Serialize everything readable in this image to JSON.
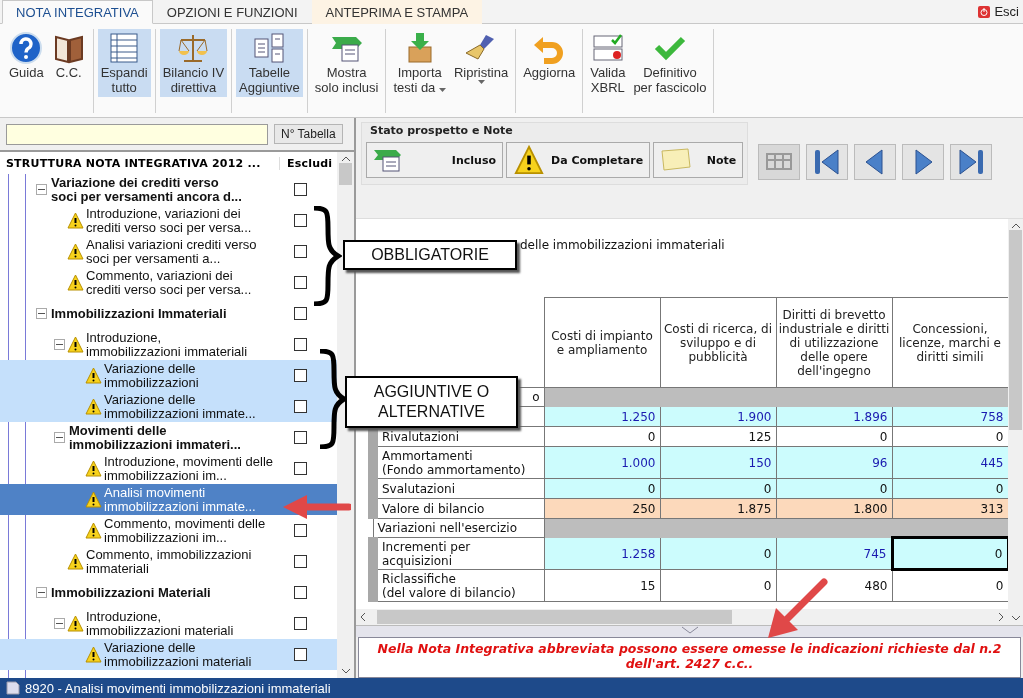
{
  "tabs": [
    {
      "label": "NOTA INTEGRATIVA",
      "selected": true,
      "kind": "main"
    },
    {
      "label": "OPZIONI E FUNZIONI",
      "selected": false,
      "kind": "main"
    },
    {
      "label": "ANTEPRIMA E STAMPA",
      "selected": false,
      "kind": "context"
    }
  ],
  "exit_button": "Esci",
  "ribbon": {
    "groups": [
      {
        "buttons": [
          {
            "label": "Guida",
            "pressed": false
          },
          {
            "label": "C.C.",
            "pressed": false
          }
        ]
      },
      {
        "buttons": [
          {
            "label": "Espandi\ntutto",
            "pressed": true
          }
        ]
      },
      {
        "buttons": [
          {
            "label": "Bilancio IV\ndirettiva",
            "pressed": true
          }
        ]
      },
      {
        "buttons": [
          {
            "label": "Tabelle\nAggiuntive",
            "pressed": true
          }
        ]
      },
      {
        "buttons": [
          {
            "label": "Mostra\nsolo inclusi",
            "pressed": false
          }
        ]
      },
      {
        "buttons": [
          {
            "label": "Importa\ntesti da",
            "pressed": false,
            "dropdown": true
          },
          {
            "label": "Ripristina",
            "pressed": false,
            "dropdown": true
          }
        ]
      },
      {
        "buttons": [
          {
            "label": "Aggiorna",
            "pressed": false
          }
        ]
      },
      {
        "buttons": [
          {
            "label": "Valida\nXBRL",
            "pressed": false
          },
          {
            "label": "Definitivo\nper fascicolo",
            "pressed": false
          }
        ]
      }
    ]
  },
  "search": {
    "button": "N° Tabella"
  },
  "tree": {
    "header": "STRUTTURA NOTA INTEGRATIVA 2012 ...",
    "exclude_header": "Escludi",
    "items": [
      {
        "label": "Variazione dei crediti verso soci per versamenti ancora d...",
        "kind": "section",
        "expanded": true,
        "selected": false,
        "highlighted": false,
        "excluded": false,
        "children": [
          {
            "label": "Introduzione, variazioni dei crediti verso soci per versa...",
            "kind": "note",
            "selected": false,
            "highlighted": false,
            "excluded": false
          },
          {
            "label": "Analisi variazioni crediti verso soci per versamenti a...",
            "kind": "note",
            "selected": false,
            "highlighted": false,
            "excluded": false
          },
          {
            "label": "Commento, variazioni dei crediti verso soci per versa...",
            "kind": "note",
            "selected": false,
            "highlighted": false,
            "excluded": false
          }
        ]
      },
      {
        "label": "Immobilizzazioni Immateriali",
        "kind": "section",
        "expanded": true,
        "selected": false,
        "highlighted": false,
        "excluded": false,
        "children": [
          {
            "label": "Introduzione, immobilizzazioni immateriali",
            "kind": "note",
            "expanded": true,
            "selected": false,
            "highlighted": false,
            "excluded": false,
            "children": [
              {
                "label": "Variazione delle immobilizzazioni",
                "kind": "note",
                "selected": false,
                "highlighted": true,
                "excluded": false
              },
              {
                "label": "Variazione delle immobilizzazioni immate...",
                "kind": "note",
                "selected": false,
                "highlighted": true,
                "excluded": false
              }
            ]
          },
          {
            "label": "Movimenti delle immobilizzazioni immateri...",
            "kind": "section",
            "expanded": true,
            "selected": false,
            "highlighted": false,
            "excluded": false,
            "children": [
              {
                "label": "Introduzione, movimenti delle immobilizzazioni im...",
                "kind": "note",
                "selected": false,
                "highlighted": false,
                "excluded": false
              },
              {
                "label": "Analisi movimenti immobilizzazioni immate...",
                "kind": "note",
                "selected": true,
                "highlighted": false
              },
              {
                "label": "Commento, movimenti delle immobilizzazioni im...",
                "kind": "note",
                "selected": false,
                "highlighted": false,
                "excluded": false
              }
            ]
          },
          {
            "label": "Commento, immobilizzazioni immateriali",
            "kind": "note",
            "selected": false,
            "highlighted": false,
            "excluded": false
          }
        ]
      },
      {
        "label": "Immobilizzazioni Materiali",
        "kind": "section",
        "expanded": true,
        "selected": false,
        "highlighted": false,
        "excluded": false,
        "children": [
          {
            "label": "Introduzione, immobilizzazioni materiali",
            "kind": "note",
            "expanded": true,
            "selected": false,
            "highlighted": false,
            "excluded": false,
            "children": [
              {
                "label": "Variazione delle immobilizzazioni materiali",
                "kind": "note",
                "selected": false,
                "highlighted": true,
                "excluded": false
              }
            ]
          }
        ]
      }
    ]
  },
  "status_panel": {
    "title": "Stato prospetto e Note",
    "buttons": [
      {
        "label": "Incluso",
        "kind": "included"
      },
      {
        "label": "Da Completare",
        "kind": "warning"
      },
      {
        "label": "Note",
        "kind": "note"
      }
    ]
  },
  "document": {
    "title": "delle immobilizzazioni immateriali",
    "columns": [
      "Costi di impianto e ampliamento",
      "Costi di ricerca, di sviluppo e di pubblicità",
      "Diritti di brevetto industriale e diritti di utilizzazione delle opere dell'ingegno",
      "Concessioni, licenze, marchi e diritti simili"
    ],
    "rows": [
      {
        "kind": "group",
        "label": "o"
      },
      {
        "kind": "item",
        "cells": [
          {
            "text": "1.250",
            "kind": "entered"
          },
          {
            "text": "1.900",
            "kind": "entered"
          },
          {
            "text": "1.896",
            "kind": "entered"
          },
          {
            "text": "758",
            "kind": "entered"
          }
        ]
      },
      {
        "kind": "item",
        "label": "Rivalutazioni",
        "cells": [
          {
            "text": "0",
            "kind": "plain"
          },
          {
            "text": "125",
            "kind": "plain"
          },
          {
            "text": "0",
            "kind": "plain"
          },
          {
            "text": "0",
            "kind": "plain"
          }
        ]
      },
      {
        "kind": "item",
        "label": "Ammortamenti\n(Fondo ammortamento)",
        "cells": [
          {
            "text": "1.000",
            "kind": "entered"
          },
          {
            "text": "150",
            "kind": "entered"
          },
          {
            "text": "96",
            "kind": "entered"
          },
          {
            "text": "445",
            "kind": "entered"
          }
        ]
      },
      {
        "kind": "item",
        "label": "Svalutazioni",
        "cells": [
          {
            "text": "0",
            "kind": "computed"
          },
          {
            "text": "0",
            "kind": "computed"
          },
          {
            "text": "0",
            "kind": "computed"
          },
          {
            "text": "0",
            "kind": "computed"
          }
        ]
      },
      {
        "kind": "item",
        "label": "Valore di bilancio",
        "cells": [
          {
            "text": "250",
            "kind": "total"
          },
          {
            "text": "1.875",
            "kind": "total"
          },
          {
            "text": "1.800",
            "kind": "total"
          },
          {
            "text": "313",
            "kind": "total"
          }
        ]
      },
      {
        "kind": "group",
        "label": "Variazioni nell'esercizio"
      },
      {
        "kind": "item",
        "label": "Incrementi per\nacquisizioni",
        "cells": [
          {
            "text": "1.258",
            "kind": "entered"
          },
          {
            "text": "0",
            "kind": "computed"
          },
          {
            "text": "745",
            "kind": "entered"
          },
          {
            "text": "0",
            "kind": "computed",
            "focused": true
          }
        ]
      },
      {
        "kind": "item",
        "label": "Riclassifiche\n(del valore di bilancio)",
        "cells": [
          {
            "text": "15",
            "kind": "plain"
          },
          {
            "text": "0",
            "kind": "plain"
          },
          {
            "text": "480",
            "kind": "plain"
          },
          {
            "text": "0",
            "kind": "plain"
          }
        ]
      }
    ]
  },
  "notice": "Nella Nota Integrativa abbreviata possono essere omesse le indicazioni richieste dal n.2 dell'art. 2427 c.c..",
  "status_bar": "8920 - Analisi movimenti immobilizzazioni immateriali",
  "annotations": [
    "OBBLIGATORIE",
    "AGGIUNTIVE O\nALTERNATIVE"
  ]
}
